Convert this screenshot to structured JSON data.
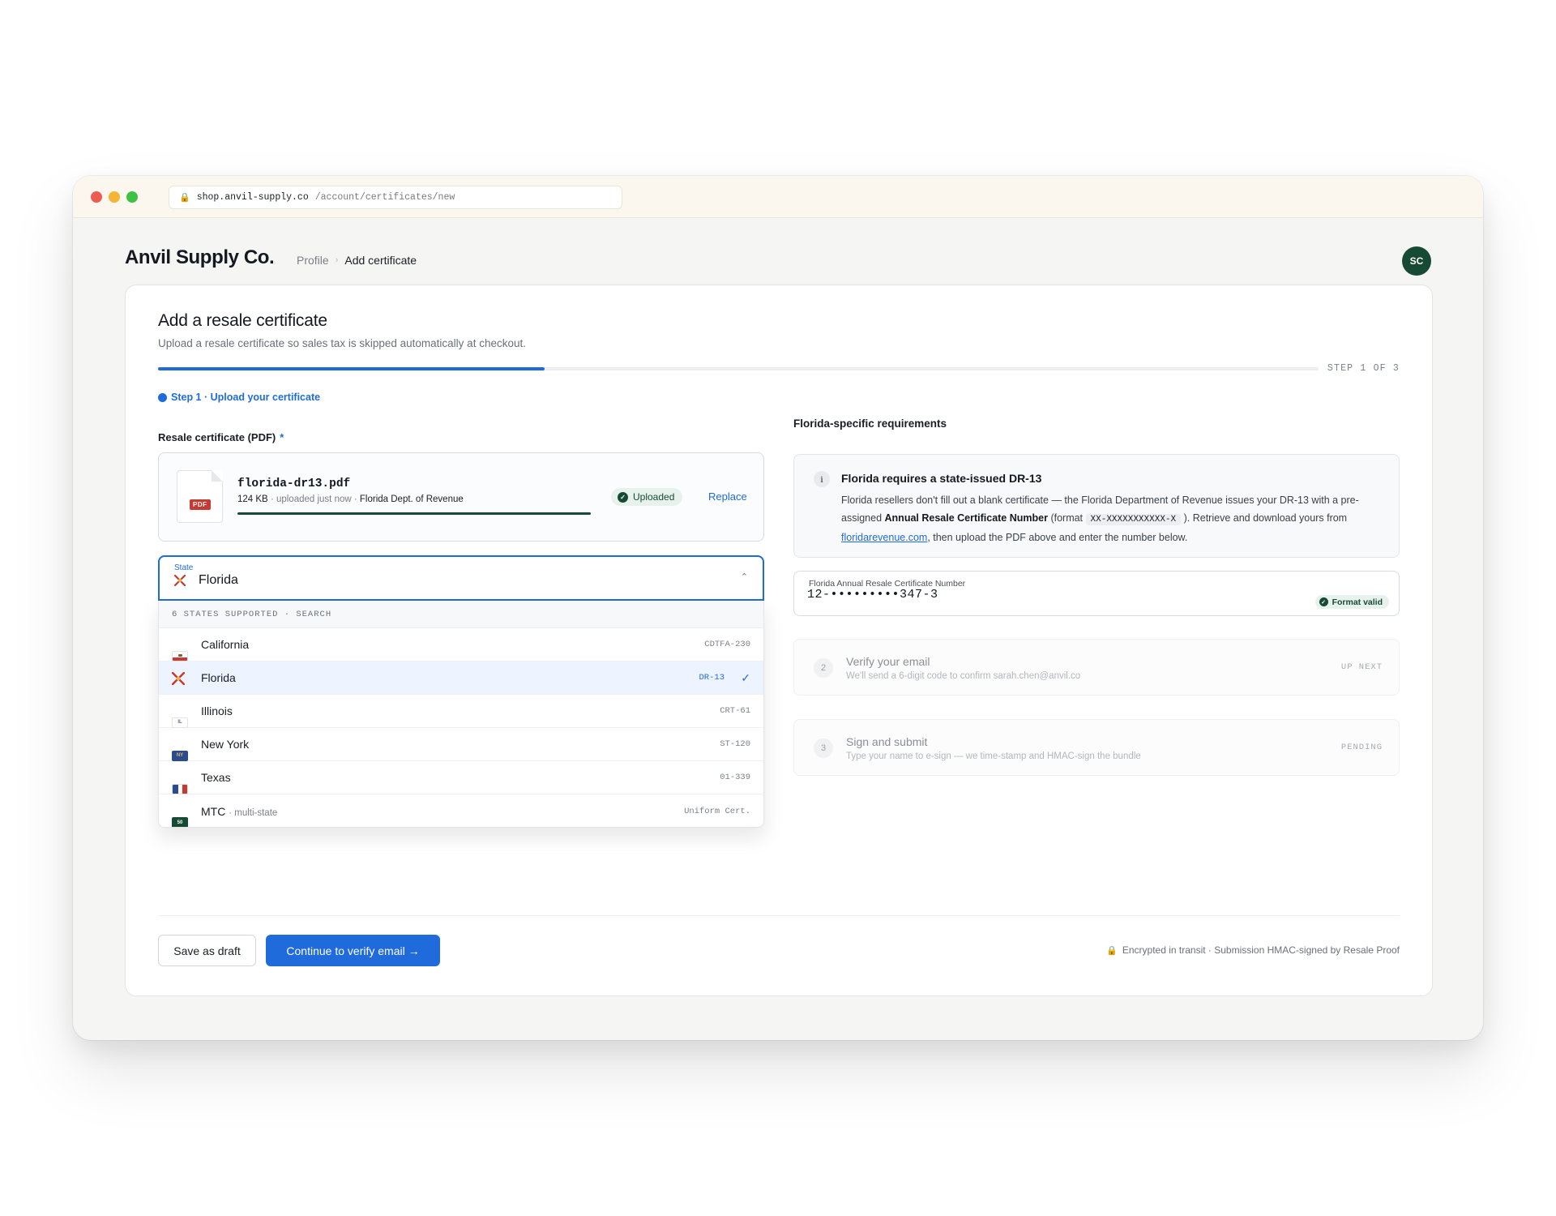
{
  "browser": {
    "url_host": "shop.anvil-supply.co",
    "url_path": "/account/certificates/new"
  },
  "header": {
    "brand": "Anvil Supply Co.",
    "breadcrumb": {
      "parent": "Profile",
      "current": "Add certificate"
    },
    "avatar_initials": "SC"
  },
  "page": {
    "title": "Add a resale certificate",
    "subtitle": "Upload a resale certificate so sales tax is skipped automatically at checkout.",
    "progress_fraction": 0.333,
    "step_count": "STEP 1 OF 3",
    "current_step": "Step 1 · Upload your certificate"
  },
  "upload": {
    "label": "Resale certificate (PDF)",
    "required_mark": "*",
    "pdf_tag": "PDF",
    "file_name": "florida-dr13.pdf",
    "file_size": "124 KB",
    "file_time": "· uploaded just now ·",
    "file_issuer": "Florida Dept. of Revenue",
    "status": "Uploaded",
    "replace_label": "Replace",
    "upload_fraction": 1.0
  },
  "state_select": {
    "label": "State",
    "value": "Florida",
    "list_header": "6 STATES SUPPORTED · SEARCH",
    "options": [
      {
        "label": "California",
        "sub": "",
        "code": "CDTFA-230",
        "flag_text": ""
      },
      {
        "label": "Florida",
        "sub": "",
        "code": "DR-13",
        "flag_text": ""
      },
      {
        "label": "Illinois",
        "sub": "",
        "code": "CRT-61",
        "flag_text": "IL"
      },
      {
        "label": "New York",
        "sub": "",
        "code": "ST-120",
        "flag_text": "NY"
      },
      {
        "label": "Texas",
        "sub": "",
        "code": "01-339",
        "flag_text": ""
      },
      {
        "label": "MTC",
        "sub": "· multi-state",
        "code": "Uniform Cert.",
        "flag_text": "50"
      }
    ]
  },
  "requirements": {
    "section_title": "Florida-specific requirements",
    "info_icon": "i",
    "info_title": "Florida requires a state-issued DR-13",
    "info_body_1": "Florida resellers don't fill out a blank certificate — the Florida Department of Revenue issues your DR-13 with a pre-assigned ",
    "info_body_bold": "Annual Resale Certificate Number",
    "info_body_2": " (format ",
    "info_format": "XX-XXXXXXXXXXX-X",
    "info_body_3": " ). Retrieve and download yours from ",
    "info_link": "floridarevenue.com",
    "info_body_4": ", then upload the PDF above and enter the number below."
  },
  "cert_number": {
    "label": "Florida Annual Resale Certificate Number",
    "value": "12-•••••••••347-3",
    "status": "Format valid"
  },
  "steps": [
    {
      "num": "2",
      "title": "Verify your email",
      "desc": "We'll send a 6-digit code to confirm sarah.chen@anvil.co",
      "status": "UP NEXT"
    },
    {
      "num": "3",
      "title": "Sign and submit",
      "desc": "Type your name to e-sign — we time-stamp and HMAC-sign the bundle",
      "status": "PENDING"
    }
  ],
  "footer": {
    "draft_label": "Save as draft",
    "continue_label": "Continue to verify email →",
    "security_note": "Encrypted in transit · Submission HMAC-signed by Resale Proof"
  },
  "colors": {
    "accent": "#1f6bdc",
    "brand_green": "#174a35",
    "pdf_red": "#c53a32"
  },
  "icons": {
    "lock": "🔒",
    "check": "✓",
    "chevron_up": "⌃"
  }
}
